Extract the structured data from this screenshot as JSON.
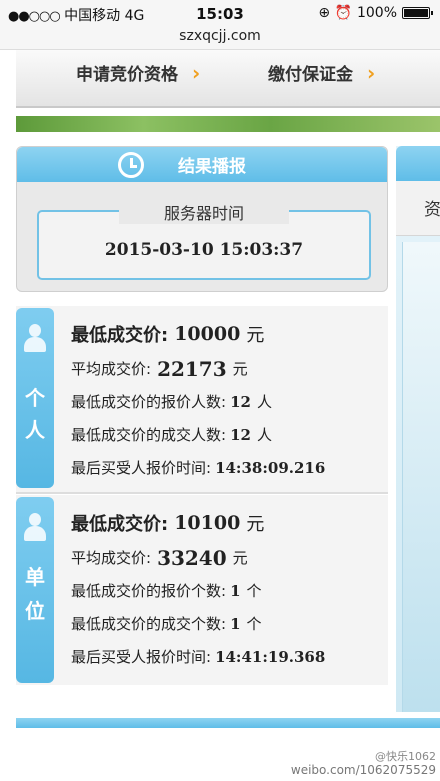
{
  "status_bar": {
    "signal": "●●○○○",
    "carrier": "中国移动",
    "network": "4G",
    "time": "15:03",
    "icons": "⊕ ⏰",
    "battery": "100%"
  },
  "url": "szxqcjj.com",
  "nav": {
    "items": [
      {
        "label": "申请竞价资格"
      },
      {
        "label": "缴付保证金"
      }
    ],
    "arrow": "›"
  },
  "result_panel": {
    "title": "结果播报",
    "server_time_label": "服务器时间",
    "server_time": "2015-03-10 15:03:37"
  },
  "right_panel": {
    "partial_char": "资"
  },
  "person": {
    "tab_label_1": "个",
    "tab_label_2": "人",
    "lowest_price_label": "最低成交价:",
    "lowest_price": "10000",
    "lowest_price_unit": "元",
    "avg_price_label": "平均成交价:",
    "avg_price": "22173",
    "avg_price_unit": "元",
    "bid_count_label": "最低成交价的报价人数:",
    "bid_count": "12",
    "bid_count_unit": "人",
    "deal_count_label": "最低成交价的成交人数:",
    "deal_count": "12",
    "deal_count_unit": "人",
    "last_time_label": "最后买受人报价时间:",
    "last_time": "14:38:09.216"
  },
  "unit_block": {
    "tab_label_1": "单",
    "tab_label_2": "位",
    "lowest_price_label": "最低成交价:",
    "lowest_price": "10100",
    "lowest_price_unit": "元",
    "avg_price_label": "平均成交价:",
    "avg_price": "33240",
    "avg_price_unit": "元",
    "bid_count_label": "最低成交价的报价个数:",
    "bid_count": "1",
    "bid_count_unit": "个",
    "deal_count_label": "最低成交价的成交个数:",
    "deal_count": "1",
    "deal_count_unit": "个",
    "last_time_label": "最后买受人报价时间:",
    "last_time": "14:41:19.368"
  },
  "watermark": {
    "handle": "@快乐1062",
    "url": "weibo.com/1062075529"
  }
}
